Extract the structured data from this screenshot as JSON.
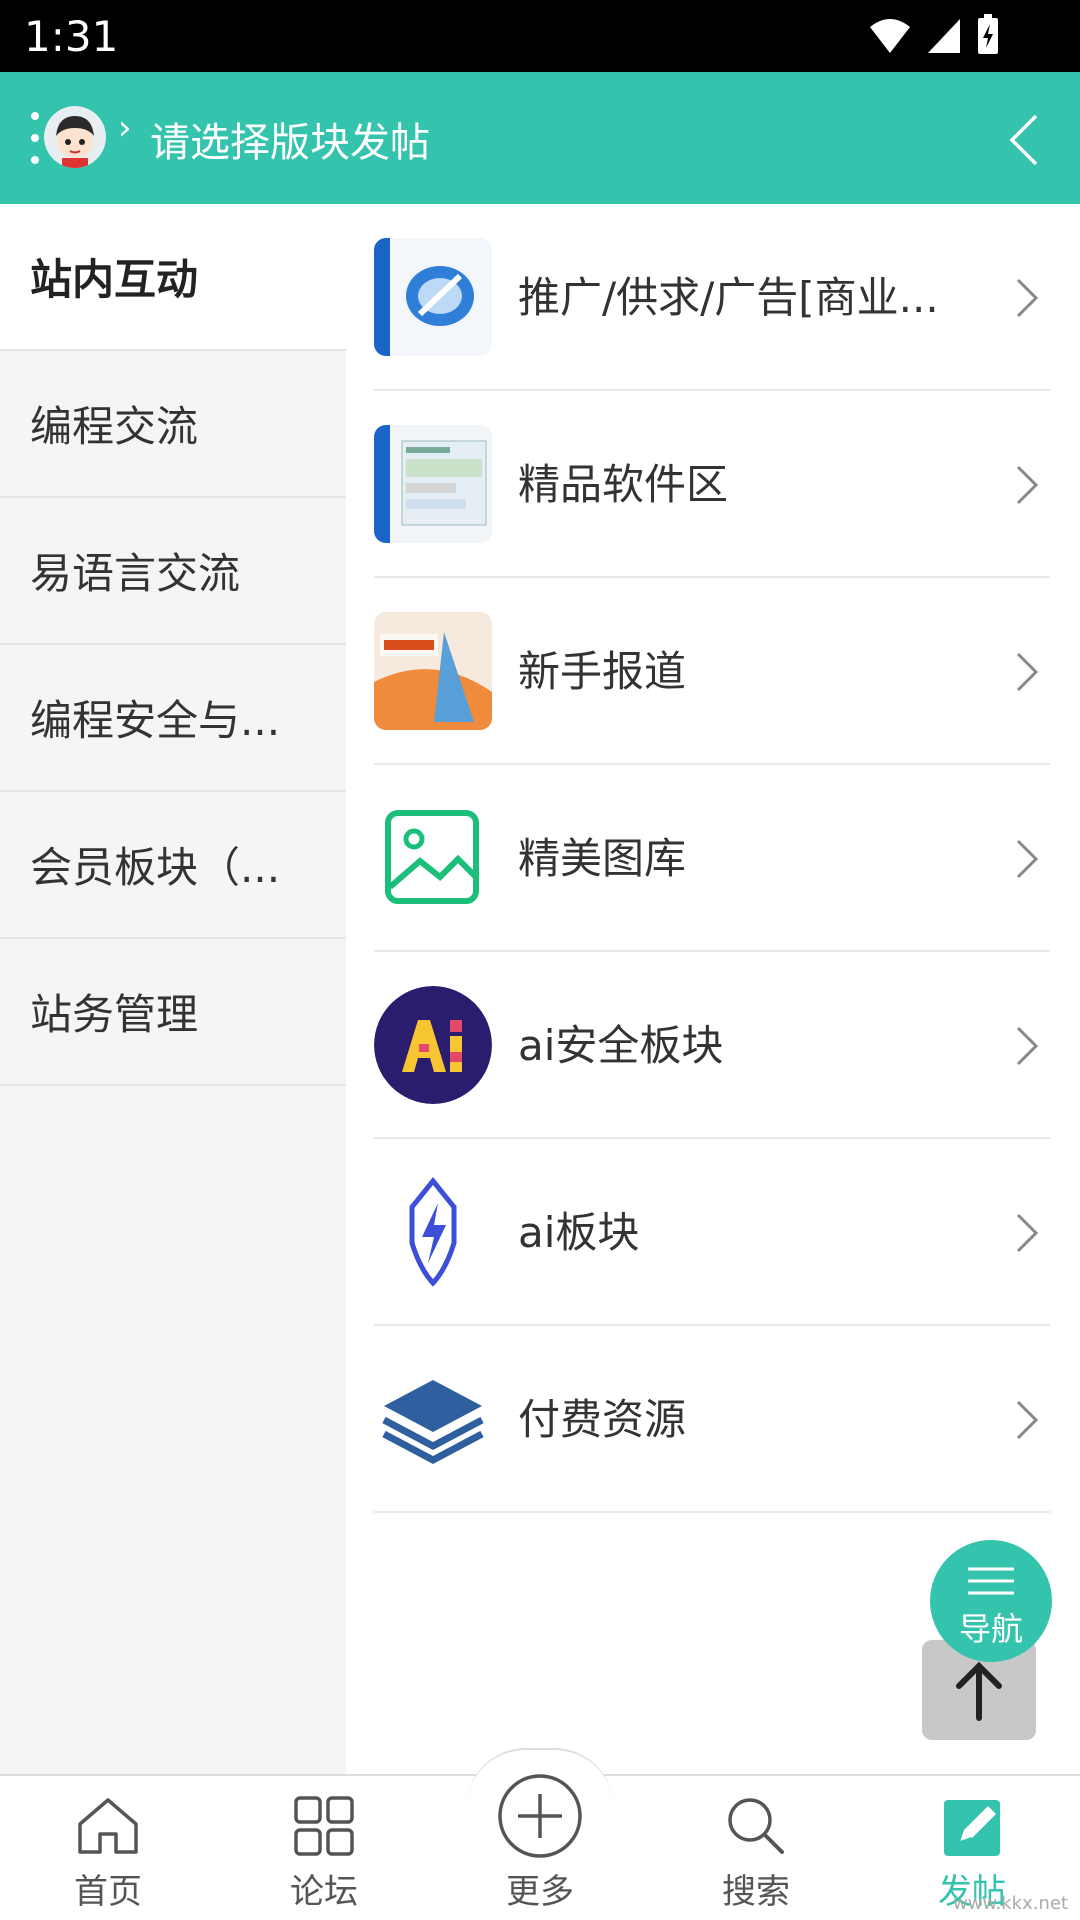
{
  "status_bar": {
    "time": "1:31"
  },
  "header": {
    "separator": "›",
    "title": "请选择版块发帖"
  },
  "sidebar": {
    "items": [
      {
        "label": "站内互动",
        "active": true
      },
      {
        "label": "编程交流"
      },
      {
        "label": "易语言交流"
      },
      {
        "label": "编程安全与..."
      },
      {
        "label": "会员板块（..."
      },
      {
        "label": "站务管理"
      }
    ]
  },
  "forums": [
    {
      "name": "推广/供求/广告[商业...",
      "icon": "wghai-promo-icon"
    },
    {
      "name": "精品软件区",
      "icon": "software-icon"
    },
    {
      "name": "新手报道",
      "icon": "newbie-report-icon"
    },
    {
      "name": "精美图库",
      "icon": "image-gallery-icon"
    },
    {
      "name": "ai安全板块",
      "icon": "ai-security-icon"
    },
    {
      "name": "ai板块",
      "icon": "ai-lightning-icon"
    },
    {
      "name": "付费资源",
      "icon": "layers-icon"
    }
  ],
  "fab": {
    "nav_label": "导航"
  },
  "bottom_nav": {
    "items": [
      {
        "label": "首页",
        "icon": "home-icon"
      },
      {
        "label": "论坛",
        "icon": "grid-icon"
      },
      {
        "label": "更多",
        "icon": "plus-circle-icon"
      },
      {
        "label": "搜索",
        "icon": "search-icon"
      },
      {
        "label": "发帖",
        "icon": "edit-icon",
        "active": true
      }
    ]
  },
  "watermark": "www.kkx.net",
  "colors": {
    "accent": "#34c3ad",
    "sidebar_bg": "#f5f5f5"
  }
}
